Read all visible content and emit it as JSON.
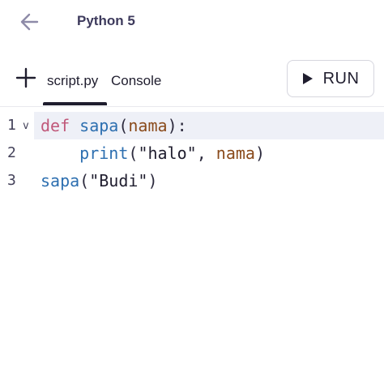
{
  "header": {
    "title": "Python 5",
    "back_icon": "arrow-left-icon"
  },
  "tabs": {
    "add_icon": "plus-icon",
    "items": [
      {
        "label": "script.py",
        "active": true
      },
      {
        "label": "Console",
        "active": false
      }
    ]
  },
  "run_button": {
    "label": "RUN",
    "icon": "play-icon"
  },
  "editor": {
    "lines": [
      {
        "number": "1",
        "fold": "v",
        "active": true,
        "tokens": [
          "def",
          " ",
          "sapa",
          "(",
          "nama",
          "):"
        ]
      },
      {
        "number": "2",
        "active": false,
        "tokens": [
          "    ",
          "print",
          "(",
          "\"halo\"",
          ", ",
          "nama",
          ")"
        ]
      },
      {
        "number": "3",
        "active": false,
        "tokens": [
          "sapa",
          "(",
          "\"Budi\"",
          ")"
        ]
      }
    ]
  },
  "colors": {
    "keyword": "#c0587a",
    "function": "#2d6fb0",
    "variable": "#8a4b1c",
    "active_line_bg": "#eef0f7",
    "title": "#3d3a5c"
  }
}
